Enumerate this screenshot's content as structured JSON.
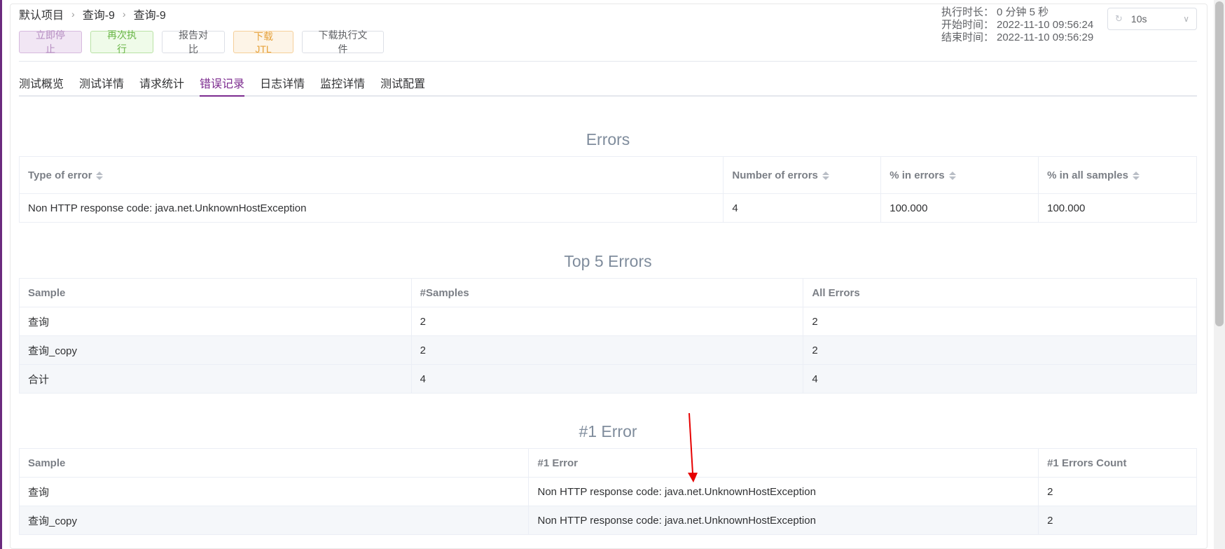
{
  "breadcrumb": {
    "items": [
      "默认项目",
      "查询-9",
      "查询-9"
    ]
  },
  "toolbar": {
    "stop_label": "立即停止",
    "rerun_label": "再次执行",
    "compare_label": "报告对比",
    "download_jtl_label": "下载JTL",
    "download_file_label": "下载执行文件"
  },
  "timing": {
    "duration_label": "执行时长：",
    "duration_value": "0 分钟 5 秒",
    "start_label": "开始时间：",
    "start_value": "2022-11-10 09:56:24",
    "end_label": "结束时间：",
    "end_value": "2022-11-10 09:56:29"
  },
  "refresh": {
    "value": "10s"
  },
  "tabs": [
    "测试概览",
    "测试详情",
    "请求统计",
    "错误记录",
    "日志详情",
    "监控详情",
    "测试配置"
  ],
  "active_tab": "错误记录",
  "errors": {
    "title": "Errors",
    "headers": [
      "Type of error",
      "Number of errors",
      "% in errors",
      "% in all samples"
    ],
    "rows": [
      [
        "Non HTTP response code: java.net.UnknownHostException",
        "4",
        "100.000",
        "100.000"
      ]
    ]
  },
  "top5": {
    "title": "Top 5 Errors",
    "headers": [
      "Sample",
      "#Samples",
      "All Errors"
    ],
    "rows": [
      [
        "查询",
        "2",
        "2"
      ],
      [
        "查询_copy",
        "2",
        "2"
      ],
      [
        "合计",
        "4",
        "4"
      ]
    ]
  },
  "error1": {
    "title": "#1 Error",
    "headers": [
      "Sample",
      "#1 Error",
      "#1 Errors Count"
    ],
    "rows": [
      [
        "查询",
        "Non HTTP response code: java.net.UnknownHostException",
        "2"
      ],
      [
        "查询_copy",
        "Non HTTP response code: java.net.UnknownHostException",
        "2"
      ]
    ]
  },
  "colors": {
    "accent": "#7c2b8f",
    "annotation_arrow": "#e60000"
  },
  "icons": {
    "breadcrumb_separator": "chevron-right-icon",
    "refresh": "refresh-icon",
    "dropdown": "chevron-down-icon",
    "sort": "sort-icon"
  }
}
